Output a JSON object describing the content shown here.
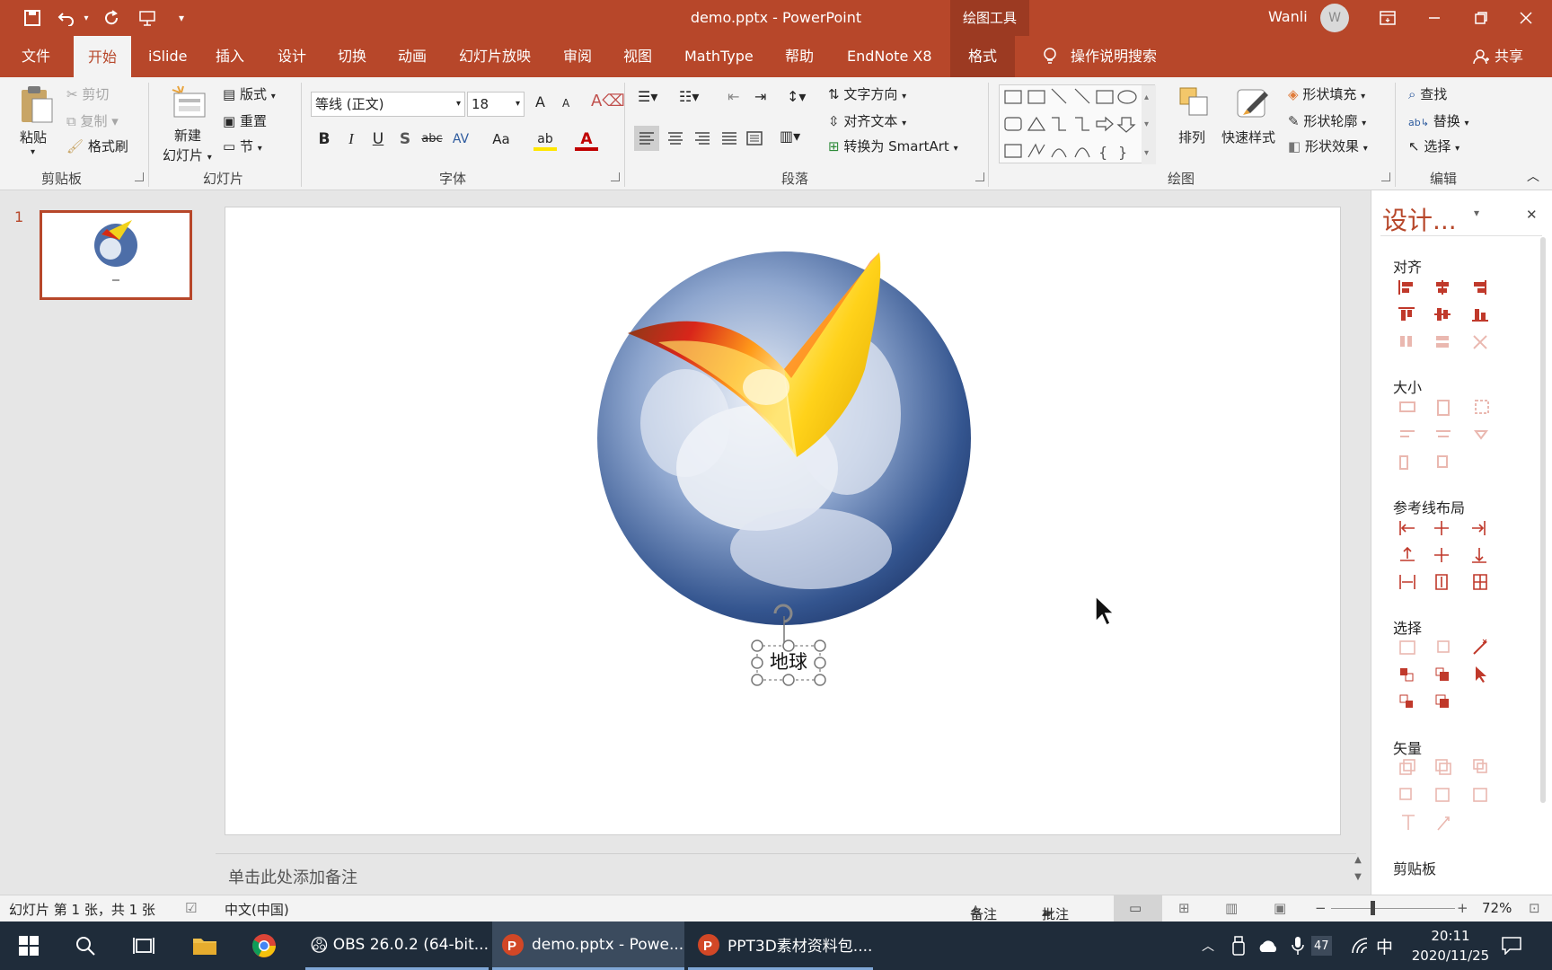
{
  "window": {
    "title": "demo.pptx  -  PowerPoint",
    "context_tab_group": "绘图工具",
    "user_name": "Wanli",
    "user_initial": "W"
  },
  "tabs": [
    "文件",
    "开始",
    "iSlide",
    "插入",
    "设计",
    "切换",
    "动画",
    "幻灯片放映",
    "审阅",
    "视图",
    "MathType",
    "帮助",
    "EndNote X8",
    "格式"
  ],
  "active_tab": "开始",
  "tell_me": "操作说明搜索",
  "share": "共享",
  "ribbon": {
    "clipboard": {
      "paste": "粘贴",
      "cut": "剪切",
      "copy": "复制",
      "format_painter": "格式刷",
      "group": "剪贴板"
    },
    "slides": {
      "new_slide_1": "新建",
      "new_slide_2": "幻灯片",
      "layout": "版式",
      "reset": "重置",
      "section": "节",
      "group": "幻灯片"
    },
    "font": {
      "font_name": "等线 (正文)",
      "font_size": "18",
      "group": "字体",
      "bold": "B",
      "italic": "I",
      "underline": "U",
      "shadow": "S",
      "strike": "abc",
      "spacing": "AV",
      "case": "Aa",
      "grow": "A",
      "shrink": "A",
      "font_color": "A",
      "highlight": "ab"
    },
    "paragraph": {
      "text_direction": "文字方向",
      "align_text": "对齐文本",
      "smartart": "转换为 SmartArt",
      "group": "段落"
    },
    "drawing": {
      "arrange": "排列",
      "quick_styles": "快速样式",
      "shape_fill": "形状填充",
      "shape_outline": "形状轮廓",
      "shape_effects": "形状效果",
      "group": "绘图"
    },
    "editing": {
      "find": "查找",
      "replace": "替换",
      "select": "选择",
      "group": "编辑"
    }
  },
  "thumbnail": {
    "number": "1"
  },
  "slide": {
    "textbox_text": "地球"
  },
  "notes_placeholder": "单击此处添加备注",
  "design_pane": {
    "title": "设计...",
    "sections": [
      "对齐",
      "大小",
      "参考线布局",
      "选择",
      "矢量",
      "剪贴板"
    ]
  },
  "status": {
    "slide_info": "幻灯片 第 1 张，共 1 张",
    "language": "中文(中国)",
    "notes": "备注",
    "comments": "批注",
    "zoom": "72%"
  },
  "taskbar": {
    "apps": [
      "OBS 26.0.2 (64-bit...",
      "demo.pptx - Powe...",
      "PPT3D素材资料包...."
    ],
    "badge": "47",
    "ime": "中",
    "time": "20:11",
    "date": "2020/11/25"
  },
  "colors": {
    "accent": "#b7472a",
    "taskbar": "#1f2c3a"
  }
}
